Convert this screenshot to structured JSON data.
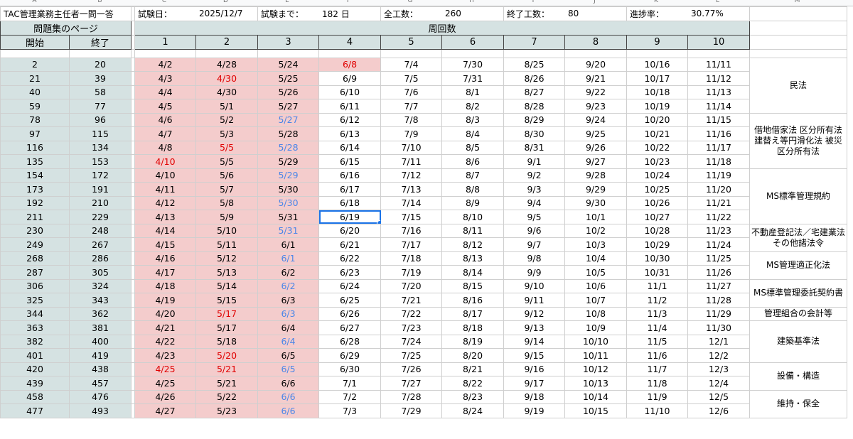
{
  "column_headers": [
    "A",
    "B",
    "C",
    "D",
    "E",
    "F",
    "G",
    "H",
    "I",
    "J",
    "K",
    "L",
    "M"
  ],
  "info": {
    "title": "TAC管理業務主任者一問一答",
    "exam_date_label": "試験日：",
    "exam_date": "2025/12/7",
    "days_left_label": "試験まで：",
    "days_left": "182 日",
    "total_label": "全工数：",
    "total": "260",
    "done_label": "終了工数：",
    "done": "80",
    "progress_label": "進捗率：",
    "progress": "30.77%"
  },
  "headers": {
    "page_group": "問題集のページ",
    "round_group": "周回数",
    "start": "開始",
    "end": "終了",
    "rounds": [
      "1",
      "2",
      "3",
      "4",
      "5",
      "6",
      "7",
      "8",
      "9",
      "10"
    ]
  },
  "rows": [
    {
      "start": "2",
      "end": "20",
      "d": [
        "4/2",
        "4/28",
        "5/24",
        "6/8",
        "7/4",
        "7/30",
        "8/25",
        "9/20",
        "10/16",
        "11/11"
      ]
    },
    {
      "start": "21",
      "end": "39",
      "d": [
        "4/3",
        "4/30",
        "5/25",
        "6/9",
        "7/5",
        "7/31",
        "8/26",
        "9/21",
        "10/17",
        "11/12"
      ]
    },
    {
      "start": "40",
      "end": "58",
      "d": [
        "4/4",
        "4/30",
        "5/26",
        "6/10",
        "7/6",
        "8/1",
        "8/27",
        "9/22",
        "10/18",
        "11/13"
      ]
    },
    {
      "start": "59",
      "end": "77",
      "d": [
        "4/5",
        "5/1",
        "5/27",
        "6/11",
        "7/7",
        "8/2",
        "8/28",
        "9/23",
        "10/19",
        "11/14"
      ]
    },
    {
      "start": "78",
      "end": "96",
      "d": [
        "4/6",
        "5/2",
        "5/27",
        "6/12",
        "7/8",
        "8/3",
        "8/29",
        "9/24",
        "10/20",
        "11/15"
      ]
    },
    {
      "start": "97",
      "end": "115",
      "d": [
        "4/7",
        "5/3",
        "5/28",
        "6/13",
        "7/9",
        "8/4",
        "8/30",
        "9/25",
        "10/21",
        "11/16"
      ]
    },
    {
      "start": "116",
      "end": "134",
      "d": [
        "4/8",
        "5/5",
        "5/28",
        "6/14",
        "7/10",
        "8/5",
        "8/31",
        "9/26",
        "10/22",
        "11/17"
      ]
    },
    {
      "start": "135",
      "end": "153",
      "d": [
        "4/10",
        "5/5",
        "5/29",
        "6/15",
        "7/11",
        "8/6",
        "9/1",
        "9/27",
        "10/23",
        "11/18"
      ]
    },
    {
      "start": "154",
      "end": "172",
      "d": [
        "4/10",
        "5/6",
        "5/29",
        "6/16",
        "7/12",
        "8/7",
        "9/2",
        "9/28",
        "10/24",
        "11/19"
      ]
    },
    {
      "start": "173",
      "end": "191",
      "d": [
        "4/11",
        "5/7",
        "5/30",
        "6/17",
        "7/13",
        "8/8",
        "9/3",
        "9/29",
        "10/25",
        "11/20"
      ]
    },
    {
      "start": "192",
      "end": "210",
      "d": [
        "4/12",
        "5/8",
        "5/30",
        "6/18",
        "7/14",
        "8/9",
        "9/4",
        "9/30",
        "10/26",
        "11/21"
      ]
    },
    {
      "start": "211",
      "end": "229",
      "d": [
        "4/13",
        "5/9",
        "5/31",
        "6/19",
        "7/15",
        "8/10",
        "9/5",
        "10/1",
        "10/27",
        "11/22"
      ]
    },
    {
      "start": "230",
      "end": "248",
      "d": [
        "4/14",
        "5/10",
        "5/31",
        "6/20",
        "7/16",
        "8/11",
        "9/6",
        "10/2",
        "10/28",
        "11/23"
      ]
    },
    {
      "start": "249",
      "end": "267",
      "d": [
        "4/15",
        "5/11",
        "6/1",
        "6/21",
        "7/17",
        "8/12",
        "9/7",
        "10/3",
        "10/29",
        "11/24"
      ]
    },
    {
      "start": "268",
      "end": "286",
      "d": [
        "4/16",
        "5/12",
        "6/1",
        "6/22",
        "7/18",
        "8/13",
        "9/8",
        "10/4",
        "10/30",
        "11/25"
      ]
    },
    {
      "start": "287",
      "end": "305",
      "d": [
        "4/17",
        "5/13",
        "6/2",
        "6/23",
        "7/19",
        "8/14",
        "9/9",
        "10/5",
        "10/31",
        "11/26"
      ]
    },
    {
      "start": "306",
      "end": "324",
      "d": [
        "4/18",
        "5/14",
        "6/2",
        "6/24",
        "7/20",
        "8/15",
        "9/10",
        "10/6",
        "11/1",
        "11/27"
      ]
    },
    {
      "start": "325",
      "end": "343",
      "d": [
        "4/19",
        "5/15",
        "6/3",
        "6/25",
        "7/21",
        "8/16",
        "9/11",
        "10/7",
        "11/2",
        "11/28"
      ]
    },
    {
      "start": "344",
      "end": "362",
      "d": [
        "4/20",
        "5/17",
        "6/3",
        "6/26",
        "7/22",
        "8/17",
        "9/12",
        "10/8",
        "11/3",
        "11/29"
      ]
    },
    {
      "start": "363",
      "end": "381",
      "d": [
        "4/21",
        "5/17",
        "6/4",
        "6/27",
        "7/23",
        "8/18",
        "9/13",
        "10/9",
        "11/4",
        "11/30"
      ]
    },
    {
      "start": "382",
      "end": "400",
      "d": [
        "4/22",
        "5/18",
        "6/4",
        "6/28",
        "7/24",
        "8/19",
        "9/14",
        "10/10",
        "11/5",
        "12/1"
      ]
    },
    {
      "start": "401",
      "end": "419",
      "d": [
        "4/23",
        "5/20",
        "6/5",
        "6/29",
        "7/25",
        "8/20",
        "9/15",
        "10/11",
        "11/6",
        "12/2"
      ]
    },
    {
      "start": "420",
      "end": "438",
      "d": [
        "4/25",
        "5/21",
        "6/5",
        "6/30",
        "7/26",
        "8/21",
        "9/16",
        "10/12",
        "11/7",
        "12/3"
      ]
    },
    {
      "start": "439",
      "end": "457",
      "d": [
        "4/25",
        "5/21",
        "6/6",
        "7/1",
        "7/27",
        "8/22",
        "9/17",
        "10/13",
        "11/8",
        "12/4"
      ]
    },
    {
      "start": "458",
      "end": "476",
      "d": [
        "4/26",
        "5/22",
        "6/6",
        "7/2",
        "7/28",
        "8/23",
        "9/18",
        "10/14",
        "11/9",
        "12/5"
      ]
    },
    {
      "start": "477",
      "end": "493",
      "d": [
        "4/27",
        "5/23",
        "6/6",
        "7/3",
        "7/29",
        "8/24",
        "9/19",
        "10/15",
        "11/10",
        "12/6"
      ]
    }
  ],
  "categories": [
    "民法",
    "借地借家法 区分所有法 建替え等円滑化法 被災区分所有法",
    "MS標準管理規約",
    "不動産登記法／宅建業法 その他諸法令",
    "MS管理適正化法",
    "MS標準管理委託契約書",
    "管理組合の会計等",
    "建築基準法",
    "設備・構造",
    "維持・保全"
  ],
  "colors": {
    "header_teal": "#d5e2e2",
    "done_pink": "#f4cccc",
    "late_red": "#e00000",
    "blue_text": "#4a86e8",
    "selection": "#1a73e8"
  }
}
